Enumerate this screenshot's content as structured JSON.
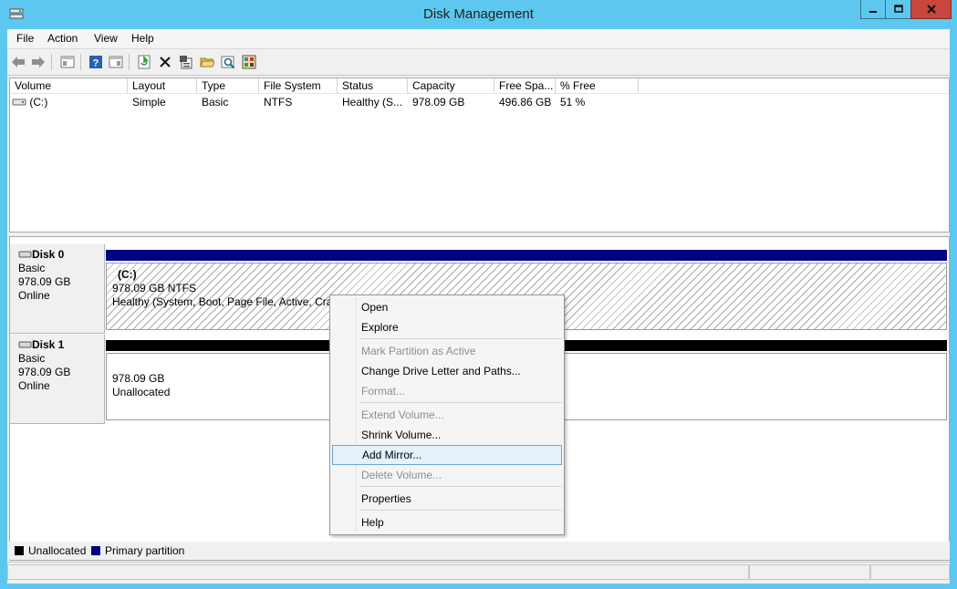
{
  "window": {
    "title": "Disk Management"
  },
  "menubar": [
    "File",
    "Action",
    "View",
    "Help"
  ],
  "toolbar": {
    "icons": [
      "back-icon",
      "forward-icon",
      "console-tree-icon",
      "help-icon",
      "properties-pane-icon",
      "refresh-icon",
      "delete-icon",
      "properties-icon",
      "open-folder-icon",
      "explore-icon",
      "action-pane-icon"
    ]
  },
  "volume_list": {
    "columns": [
      "Volume",
      "Layout",
      "Type",
      "File System",
      "Status",
      "Capacity",
      "Free Spa...",
      "% Free"
    ],
    "rows": [
      [
        "(C:)",
        "Simple",
        "Basic",
        "NTFS",
        "Healthy (S...",
        "978.09 GB",
        "496.86 GB",
        "51 %"
      ]
    ]
  },
  "disks": [
    {
      "name": "Disk 0",
      "type": "Basic",
      "size": "978.09 GB",
      "status": "Online",
      "volume": {
        "label": "(C:)",
        "line1": "978.09 GB NTFS",
        "line2": "Healthy (System, Boot, Page File, Active, Cras"
      }
    },
    {
      "name": "Disk 1",
      "type": "Basic",
      "size": "978.09 GB",
      "status": "Online",
      "volume": {
        "label": "",
        "line1": "978.09 GB",
        "line2": "Unallocated"
      }
    }
  ],
  "legend": {
    "unallocated": "Unallocated",
    "primary": "Primary partition"
  },
  "colors": {
    "primary_partition": "#000080",
    "unallocated": "#000000",
    "highlight": "#e5f1fb"
  },
  "context_menu": {
    "items": [
      {
        "label": "Open",
        "disabled": false
      },
      {
        "label": "Explore",
        "disabled": false
      },
      {
        "label": "Mark Partition as Active",
        "disabled": true
      },
      {
        "label": "Change Drive Letter and Paths...",
        "disabled": false
      },
      {
        "label": "Format...",
        "disabled": true
      },
      {
        "label": "Extend Volume...",
        "disabled": true
      },
      {
        "label": "Shrink Volume...",
        "disabled": false
      },
      {
        "label": "Add Mirror...",
        "disabled": false,
        "highlighted": true
      },
      {
        "label": "Delete Volume...",
        "disabled": true
      },
      {
        "label": "Properties",
        "disabled": false
      },
      {
        "label": "Help",
        "disabled": false
      }
    ]
  }
}
